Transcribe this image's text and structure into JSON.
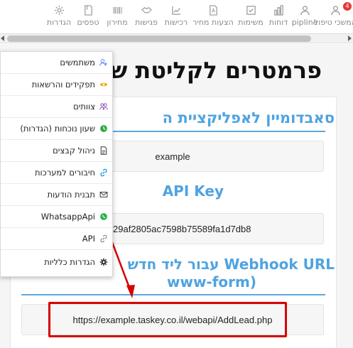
{
  "colors": {
    "accent": "#4fa3e0",
    "highlight": "#d60000",
    "notification": "#e53935"
  },
  "notifications": {
    "count": "4"
  },
  "topnav": {
    "items": [
      {
        "label": "המשכי טיפול",
        "icon": "person-icon"
      },
      {
        "label": "pipline",
        "icon": "person-icon"
      },
      {
        "label": "דוחות",
        "icon": "bar-chart-icon"
      },
      {
        "label": "משימות",
        "icon": "checkbox-icon"
      },
      {
        "label": "הצעות מחיר",
        "icon": "document-icon"
      },
      {
        "label": "רכישות",
        "icon": "growth-chart-icon"
      },
      {
        "label": "פגישות",
        "icon": "handshake-icon"
      },
      {
        "label": "מחירון",
        "icon": "barcode-icon"
      },
      {
        "label": "טפסים",
        "icon": "form-icon"
      },
      {
        "label": "הגדרות",
        "icon": "gear-icon"
      }
    ]
  },
  "page": {
    "title": "פרמטרים לקליטת ש"
  },
  "sections": [
    {
      "title": "סאבדומיין לאפליקציית ה",
      "value": "example"
    },
    {
      "title": "API Key",
      "value": "29af2805ac7598b75589fa1d7db8"
    },
    {
      "title_line1": "Webhook URL עבור ליד חדש",
      "title_line2": "(www-form",
      "value": "https://example.taskey.co.il/webapi/AddLead.php"
    }
  ],
  "menu": {
    "items": [
      {
        "label": "משתמשים",
        "icon": "users-icon",
        "color": "#5b8def"
      },
      {
        "label": "תפקידים והרשאות",
        "icon": "eye-icon",
        "color": "#f0a000"
      },
      {
        "label": "צוותים",
        "icon": "team-icon",
        "color": "#8e44ad"
      },
      {
        "label": "שעון נוכחות (הגדרות)",
        "icon": "clock-icon",
        "color": "#2eaa44"
      },
      {
        "label": "ניהול קבצים",
        "icon": "file-icon",
        "color": "#333333"
      },
      {
        "label": "חיבורים למערכות",
        "icon": "link-icon",
        "color": "#1e9be0"
      },
      {
        "label": "תבנית הודעות",
        "icon": "envelope-icon",
        "color": "#333333"
      },
      {
        "label": "WhatsappApi",
        "icon": "whatsapp-icon",
        "color": "#25b34a"
      },
      {
        "label": "API",
        "icon": "link-icon",
        "color": "#777777"
      },
      {
        "label": "הגדרות כלליות",
        "icon": "gear-icon",
        "color": "#333333"
      }
    ]
  }
}
